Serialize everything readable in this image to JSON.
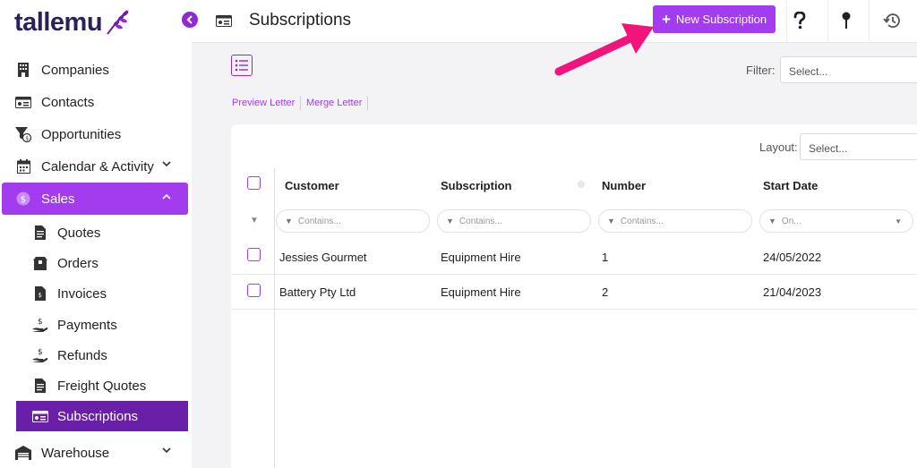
{
  "brand": {
    "name": "tallemu",
    "color": "#2b1f5c",
    "accent": "#a33bef",
    "active_sub": "#6a1fa8"
  },
  "sidebar": {
    "items": [
      {
        "label": "Companies",
        "icon": "building-icon"
      },
      {
        "label": "Contacts",
        "icon": "id-card-icon"
      },
      {
        "label": "Opportunities",
        "icon": "funnel-dollar-icon"
      },
      {
        "label": "Calendar & Activity",
        "icon": "calendar-icon"
      },
      {
        "label": "Sales",
        "icon": "dollar-circle-icon"
      },
      {
        "label": "Warehouse",
        "icon": "warehouse-icon"
      }
    ],
    "sales_sub": [
      {
        "label": "Quotes",
        "icon": "document-icon"
      },
      {
        "label": "Orders",
        "icon": "box-icon"
      },
      {
        "label": "Invoices",
        "icon": "invoice-icon"
      },
      {
        "label": "Payments",
        "icon": "hand-dollar-icon"
      },
      {
        "label": "Refunds",
        "icon": "hand-dollar-icon"
      },
      {
        "label": "Freight Quotes",
        "icon": "document-icon"
      },
      {
        "label": "Subscriptions",
        "icon": "id-card-icon"
      }
    ]
  },
  "header": {
    "title": "Subscriptions",
    "new_button": "New Subscription",
    "help_icon": "question-icon",
    "pin_icon": "pin-icon",
    "history_icon": "history-icon"
  },
  "toolbar": {
    "filter_label": "Filter:",
    "filter_placeholder": "Select...",
    "preview_letter": "Preview Letter",
    "merge_letter": "Merge Letter",
    "layout_label": "Layout:",
    "layout_placeholder": "Select..."
  },
  "table": {
    "columns": [
      "Customer",
      "Subscription",
      "Number",
      "Start Date"
    ],
    "filters": [
      "Contains...",
      "Contains...",
      "Contains...",
      "On..."
    ],
    "rows": [
      {
        "customer": "Jessies Gourmet",
        "subscription": "Equipment Hire",
        "number": "1",
        "start_date": "24/05/2022"
      },
      {
        "customer": "Battery Pty Ltd",
        "subscription": "Equipment Hire",
        "number": "2",
        "start_date": "21/04/2023"
      }
    ]
  }
}
